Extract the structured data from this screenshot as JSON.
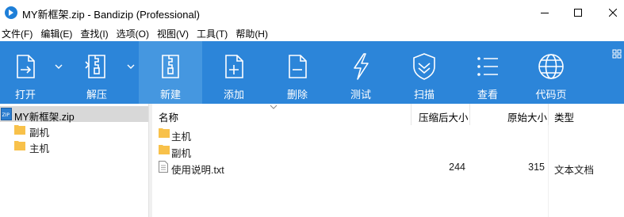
{
  "window": {
    "title": "MY新框架.zip - Bandizip (Professional)",
    "app_icon": "bandizip-logo-icon",
    "controls": [
      "minimize-icon",
      "maximize-icon",
      "close-icon"
    ]
  },
  "menu": {
    "items": [
      "文件(F)",
      "编辑(E)",
      "查找(I)",
      "选项(O)",
      "视图(V)",
      "工具(T)",
      "帮助(H)"
    ]
  },
  "toolbar": {
    "background": "#2c85d9",
    "buttons": [
      {
        "label": "打开",
        "icon": "open-file-icon",
        "dropdown": true
      },
      {
        "label": "解压",
        "icon": "extract-zipper-icon",
        "dropdown": true
      },
      {
        "label": "新建",
        "icon": "new-archive-zipper-icon",
        "active": true
      },
      {
        "label": "添加",
        "icon": "add-file-icon"
      },
      {
        "label": "删除",
        "icon": "delete-file-icon"
      },
      {
        "label": "测试",
        "icon": "test-lightning-icon"
      },
      {
        "label": "扫描",
        "icon": "scan-shield-icon"
      },
      {
        "label": "查看",
        "icon": "view-list-icon"
      },
      {
        "label": "代码页",
        "icon": "codepage-globe-icon"
      }
    ]
  },
  "tree": {
    "root": "MY新框架.zip",
    "children": [
      "副机",
      "主机"
    ]
  },
  "list": {
    "columns": {
      "name": "名称",
      "compressed": "压缩后大小",
      "original": "原始大小",
      "type": "类型"
    },
    "rows": [
      {
        "name": "主机",
        "kind": "folder",
        "compressed": "",
        "original": "",
        "type": ""
      },
      {
        "name": "副机",
        "kind": "folder",
        "compressed": "",
        "original": "",
        "type": ""
      },
      {
        "name": "使用说明.txt",
        "kind": "file",
        "compressed": "244",
        "original": "315",
        "type": "文本文档"
      }
    ]
  },
  "colors": {
    "folder": "#f8c14a",
    "selection": "#d8d8d8",
    "accent": "#1e7fd8"
  }
}
